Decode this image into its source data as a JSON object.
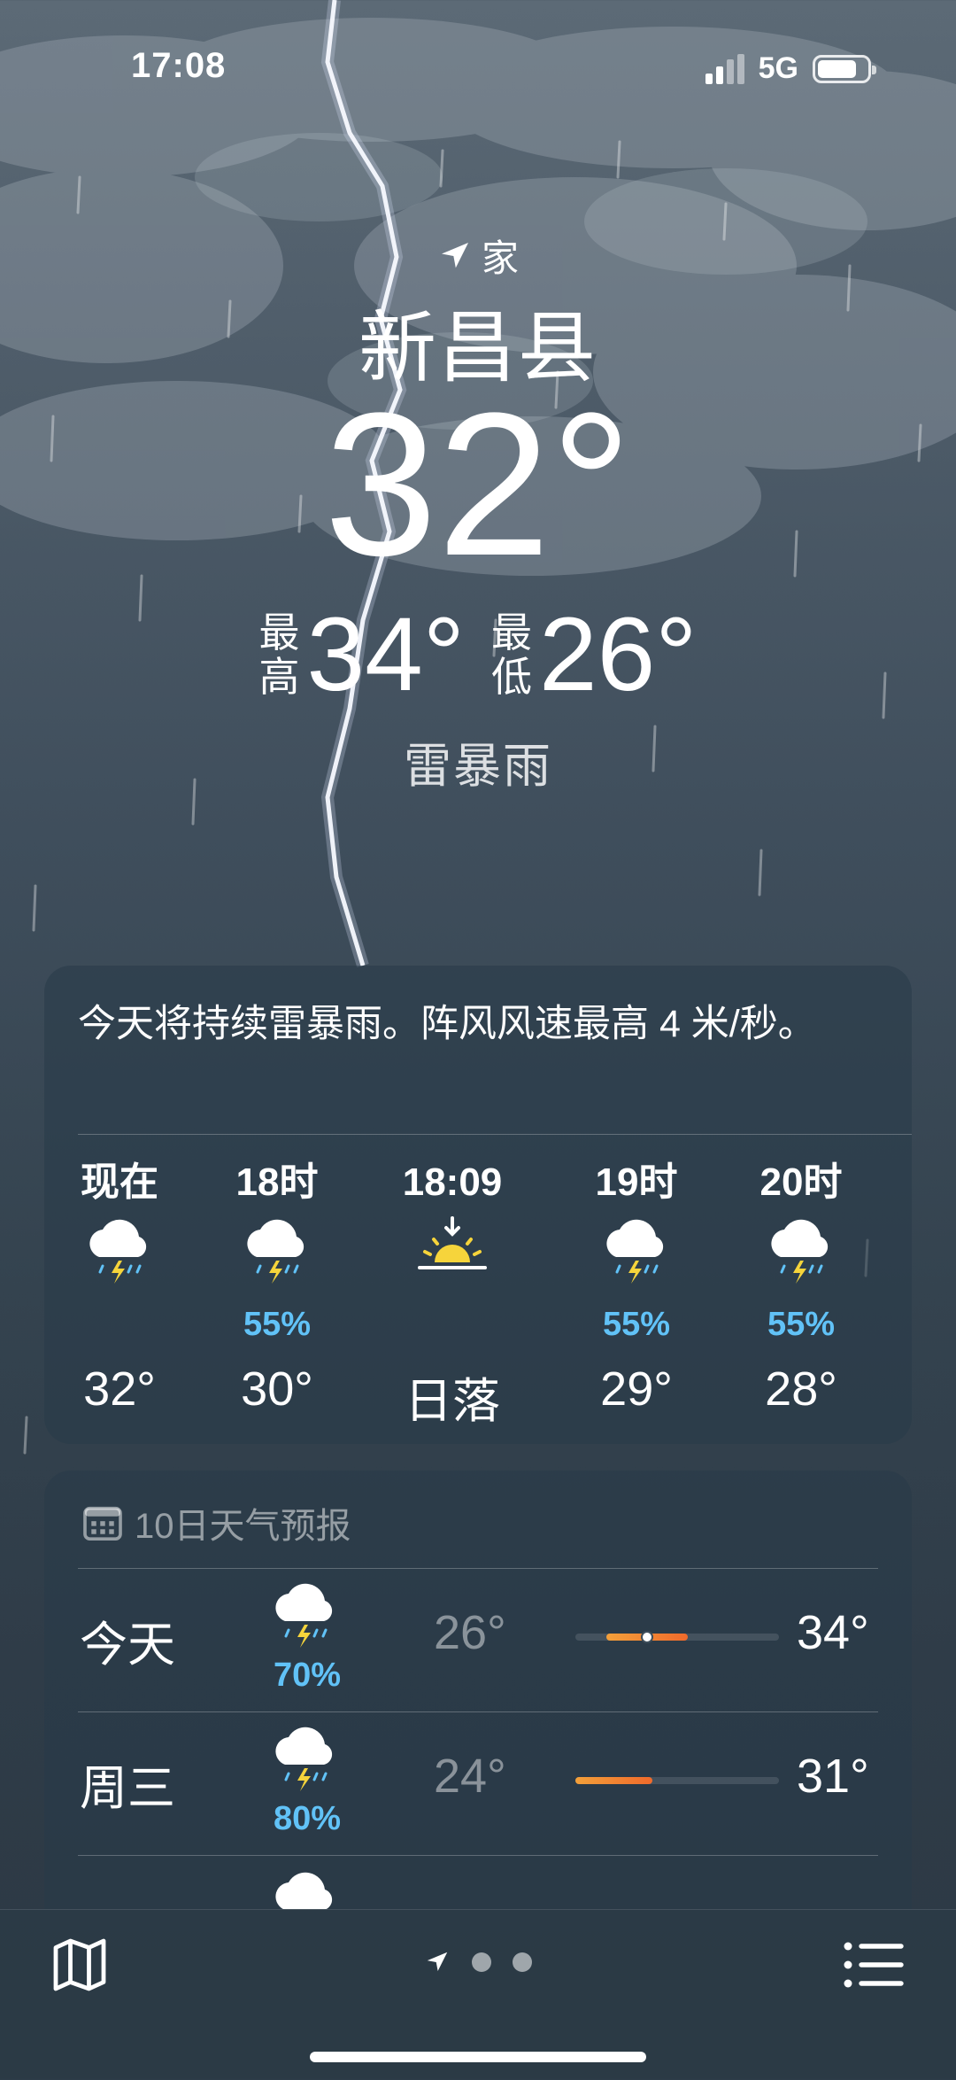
{
  "status_bar": {
    "time": "17:08",
    "network": "5G",
    "battery_level": 0.8
  },
  "location": {
    "tag": "家",
    "city": "新昌县"
  },
  "current": {
    "temperature": "32°",
    "high_label": [
      "最",
      "高"
    ],
    "high": "34°",
    "low_label": [
      "最",
      "低"
    ],
    "low": "26°",
    "condition": "雷暴雨"
  },
  "hourly": {
    "summary": "今天将持续雷暴雨。阵风风速最高 4 米/秒。",
    "items": [
      {
        "label": "现在",
        "icon": "thunderstorm-icon",
        "pct": "",
        "temp": "32°"
      },
      {
        "label": "18时",
        "icon": "thunderstorm-icon",
        "pct": "55%",
        "temp": "30°"
      },
      {
        "label": "18:09",
        "icon": "sunset-icon",
        "pct": "",
        "temp": "日落"
      },
      {
        "label": "19时",
        "icon": "thunderstorm-icon",
        "pct": "55%",
        "temp": "29°"
      },
      {
        "label": "20时",
        "icon": "thunderstorm-icon",
        "pct": "55%",
        "temp": "28°"
      }
    ]
  },
  "ten_day": {
    "header": "10日天气预报",
    "days": [
      {
        "name": "今天",
        "icon": "thunderstorm-icon",
        "pct": "70%",
        "low": "26°",
        "high": "34°",
        "range_start": 0.15,
        "range_end": 0.55,
        "current": 0.35
      },
      {
        "name": "周三",
        "icon": "thunderstorm-icon",
        "pct": "80%",
        "low": "24°",
        "high": "31°",
        "range_start": 0.0,
        "range_end": 0.38
      }
    ]
  },
  "colors": {
    "accent_blue": "#61c2f7",
    "range_orange": "#f06a2b",
    "range_yellow": "#f3a03a"
  }
}
